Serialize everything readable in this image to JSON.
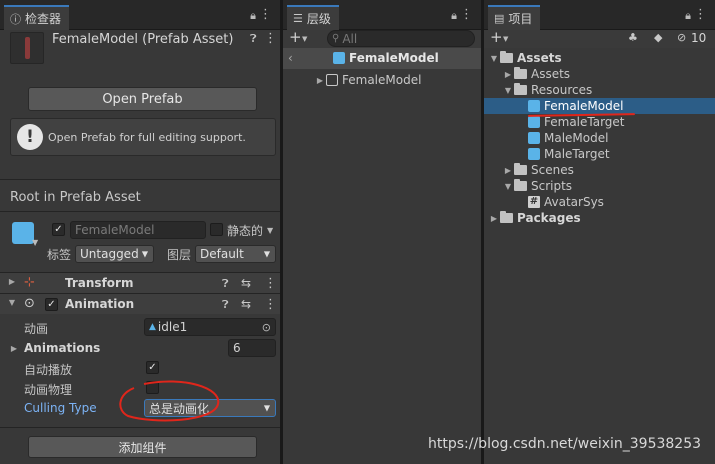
{
  "inspector": {
    "tab_title": "检查器",
    "asset_title": "FemaleModel (Prefab Asset)",
    "open_prefab": "Open Prefab",
    "info_text": "Open Prefab for full editing support.",
    "root_label": "Root in Prefab Asset",
    "go_name": "FemaleModel",
    "static_label": "静态的",
    "tag_label": "标签",
    "tag_value": "Untagged",
    "layer_label": "图层",
    "layer_value": "Default",
    "transform_label": "Transform",
    "animation_label": "Animation",
    "anim_field_label": "动画",
    "anim_field_value": "idle1",
    "animations_label": "Animations",
    "animations_count": "6",
    "auto_play_label": "自动播放",
    "anim_physics_label": "动画物理",
    "culling_label": "Culling Type",
    "culling_value": "总是动画化",
    "add_component": "添加组件"
  },
  "hierarchy": {
    "tab_title": "层级",
    "search_placeholder": "All",
    "root_item": "FemaleModel",
    "child_item": "FemaleModel"
  },
  "project": {
    "tab_title": "项目",
    "badge_count": "10",
    "tree": [
      {
        "label": "Assets",
        "bold": true,
        "type": "folder",
        "expanded": true
      },
      {
        "label": "Assets",
        "bold": false,
        "type": "folder",
        "expanded": false
      },
      {
        "label": "Resources",
        "bold": false,
        "type": "folder",
        "expanded": true
      },
      {
        "label": "FemaleModel",
        "bold": false,
        "type": "prefab",
        "selected": true
      },
      {
        "label": "FemaleTarget",
        "bold": false,
        "type": "prefab"
      },
      {
        "label": "MaleModel",
        "bold": false,
        "type": "prefab"
      },
      {
        "label": "MaleTarget",
        "bold": false,
        "type": "prefab"
      },
      {
        "label": "Scenes",
        "bold": false,
        "type": "folder",
        "expanded": false
      },
      {
        "label": "Scripts",
        "bold": false,
        "type": "folder",
        "expanded": true
      },
      {
        "label": "AvatarSys",
        "bold": false,
        "type": "script"
      },
      {
        "label": "Packages",
        "bold": true,
        "type": "folder",
        "expanded": false
      }
    ]
  },
  "watermark": "https://blog.csdn.net/weixin_39538253",
  "colors": {
    "accent": "#3a79bb",
    "selection": "#2c5d87",
    "prefab_blue": "#5ab3e8",
    "annotation_red": "#e0261b",
    "link_blue": "#7cb3f5"
  }
}
